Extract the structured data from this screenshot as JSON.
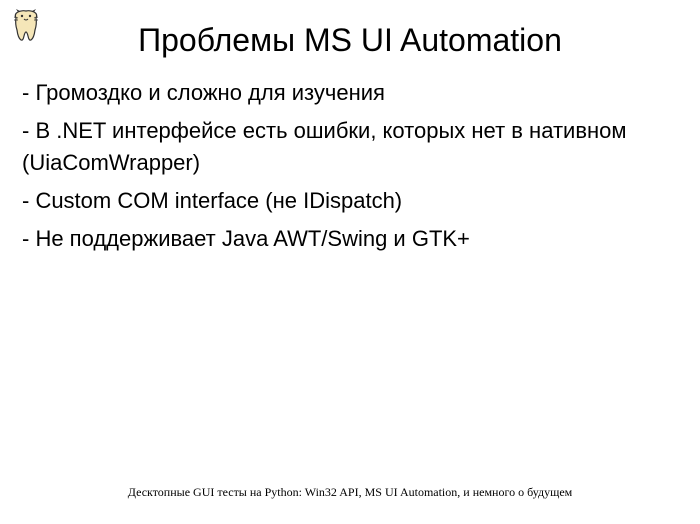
{
  "slide": {
    "title": "Проблемы MS UI Automation",
    "bullets": [
      " - Громоздко и сложно для изучения",
      " - В .NET интерфейсе есть ошибки, которых нет в нативном (UiaComWrapper)",
      " - Custom COM interface (не IDispatch)",
      " - Не поддерживает Java AWT/Swing и GTK+"
    ],
    "footer": "Десктопные GUI тесты на Python: Win32 API, MS UI Automation, и немного о будущем"
  },
  "icons": {
    "logo": "tooth-cat-logo"
  }
}
